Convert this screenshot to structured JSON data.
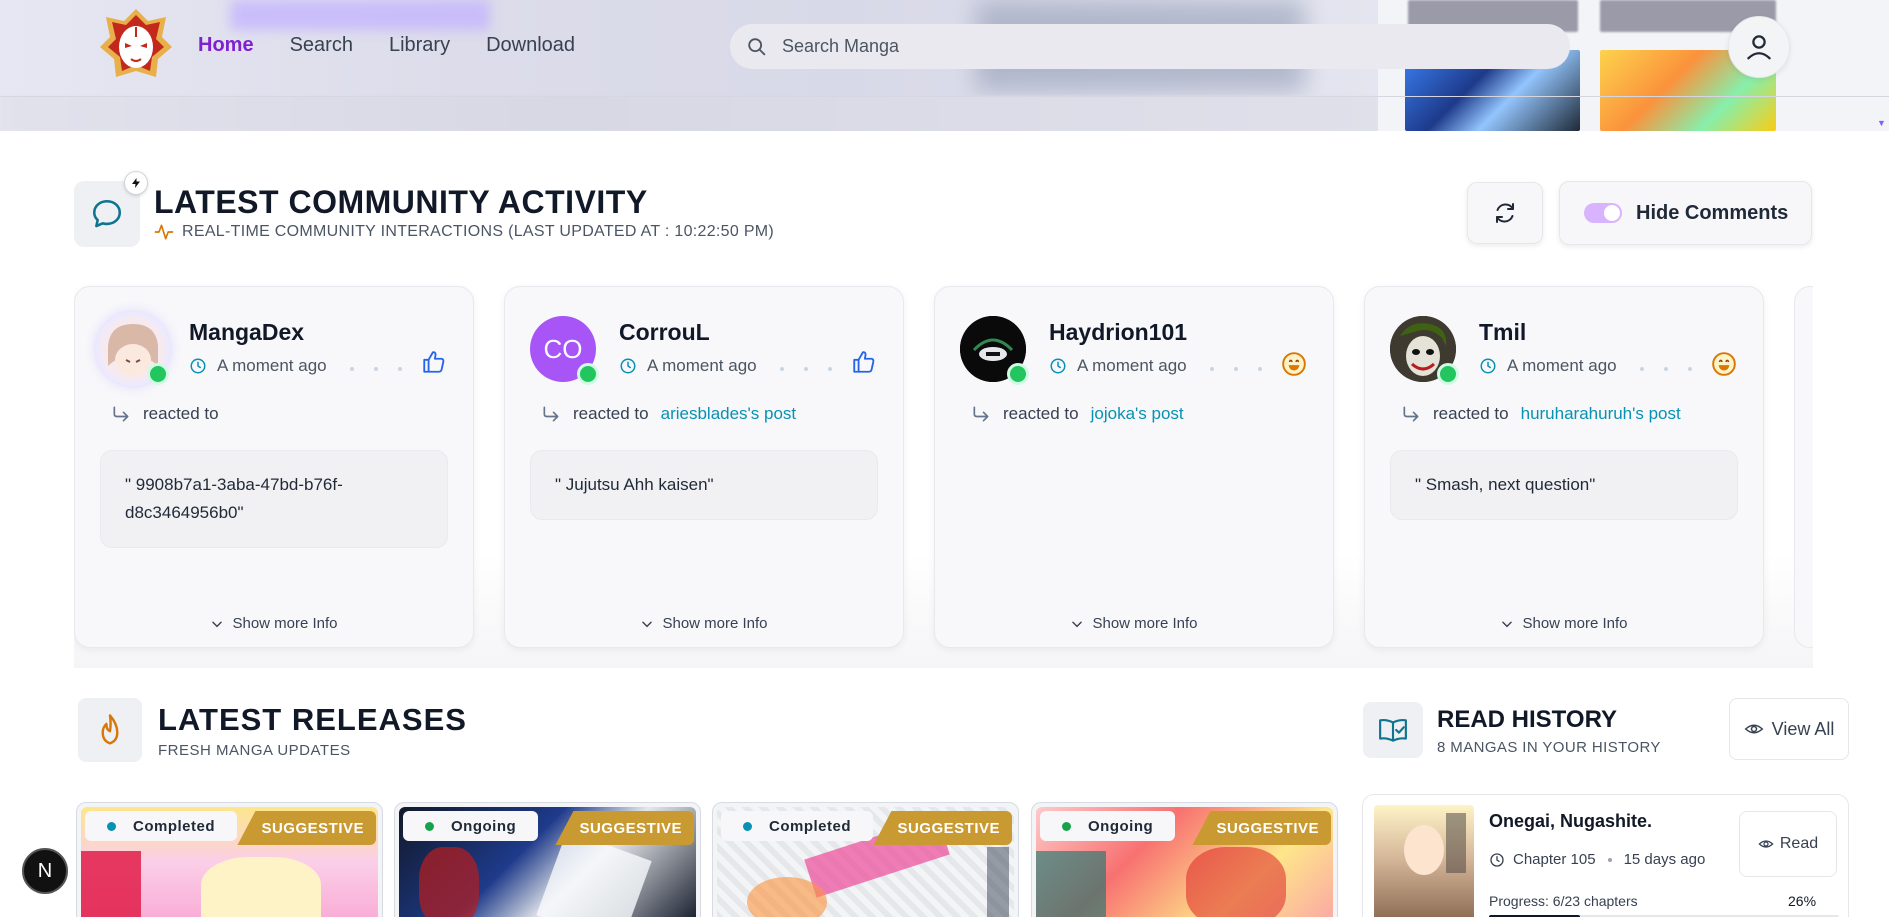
{
  "nav": {
    "links": [
      {
        "label": "Home",
        "active": true
      },
      {
        "label": "Search",
        "active": false
      },
      {
        "label": "Library",
        "active": false
      },
      {
        "label": "Download",
        "active": false
      }
    ],
    "search_placeholder": "Search Manga",
    "accent_color": "#7e22ce"
  },
  "community": {
    "title": "LATEST COMMUNITY ACTIVITY",
    "subtitle": "REAL-TIME COMMUNITY INTERACTIONS (LAST UPDATED AT : 10:22:50 PM)",
    "hide_label": "Hide Comments",
    "cards": [
      {
        "user": "MangaDex",
        "time": "A moment ago",
        "reaction": "thumbs-up-icon",
        "action": "reacted to",
        "target": "",
        "quote": "\" 9908b7a1-3aba-47bd-b76f-d8c3464956b0\"",
        "more": "Show more Info"
      },
      {
        "user": "CorrouL",
        "initials": "CO",
        "time": "A moment ago",
        "reaction": "thumbs-up-icon",
        "action": "reacted to",
        "target": "ariesblades's post",
        "quote": "\" Jujutsu Ahh kaisen\"",
        "more": "Show more Info"
      },
      {
        "user": "Haydrion101",
        "time": "A moment ago",
        "reaction": "laugh-emoji-icon",
        "action": "reacted to",
        "target": "jojoka's post",
        "quote": "",
        "more": "Show more Info"
      },
      {
        "user": "Tmil",
        "time": "A moment ago",
        "reaction": "laugh-emoji-icon",
        "action": "reacted to",
        "target": "huruharahuruh's post",
        "quote": "\" Smash, next question\"",
        "more": "Show more Info"
      }
    ]
  },
  "releases": {
    "title": "LATEST RELEASES",
    "subtitle": "FRESH MANGA UPDATES",
    "items": [
      {
        "status": "Completed",
        "dot_color": "#0891b2",
        "badge": "SUGGESTIVE"
      },
      {
        "status": "Ongoing",
        "dot_color": "#16a34a",
        "badge": "SUGGESTIVE"
      },
      {
        "status": "Completed",
        "dot_color": "#0891b2",
        "badge": "SUGGESTIVE"
      },
      {
        "status": "Ongoing",
        "dot_color": "#16a34a",
        "badge": "SUGGESTIVE"
      }
    ]
  },
  "history": {
    "title": "READ HISTORY",
    "subtitle": "8 MANGAS IN YOUR HISTORY",
    "view_all": "View All",
    "item": {
      "name": "Onegai, Nugashite.",
      "chapter": "Chapter 105",
      "ago": "15 days ago",
      "read_label": "Read",
      "progress": "Progress: 6/23 chapters",
      "percent_label": "26%",
      "percent": 26
    }
  },
  "dev_badge": "N"
}
